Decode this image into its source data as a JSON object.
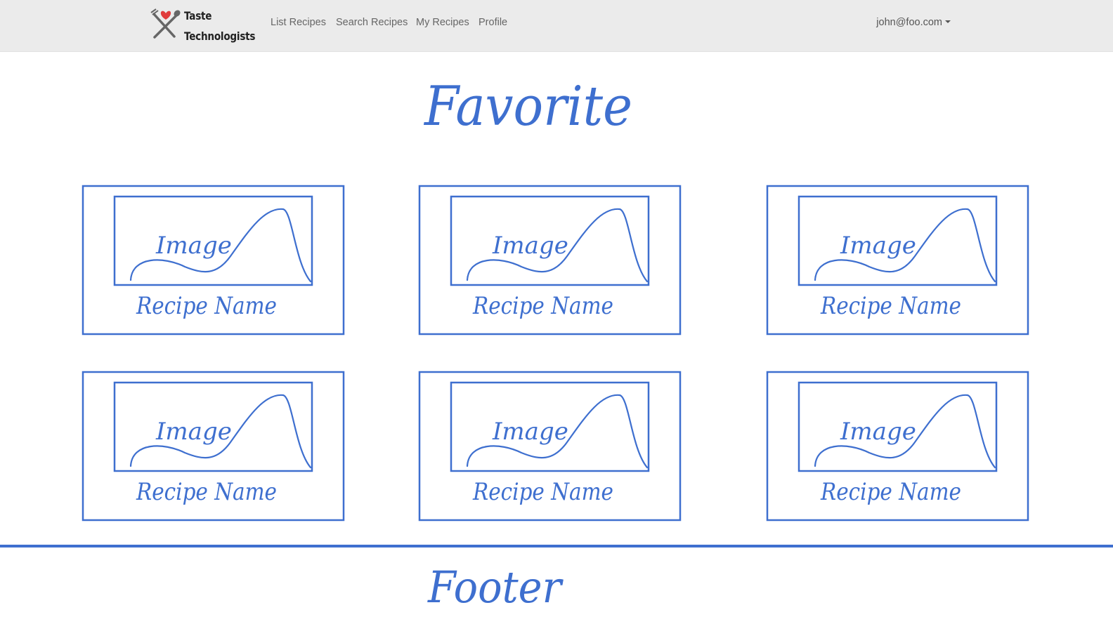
{
  "navbar": {
    "brand": {
      "line1": "Taste",
      "line2": "Technologists"
    },
    "links": [
      "List Recipes",
      "Search Recipes",
      "My Recipes",
      "Profile"
    ],
    "user": "john@foo.com"
  },
  "main": {
    "title": "Favorite",
    "cards": [
      {
        "image_label": "Image",
        "name": "Recipe Name"
      },
      {
        "image_label": "Image",
        "name": "Recipe Name"
      },
      {
        "image_label": "Image",
        "name": "Recipe Name"
      },
      {
        "image_label": "Image",
        "name": "Recipe Name"
      },
      {
        "image_label": "Image",
        "name": "Recipe Name"
      },
      {
        "image_label": "Image",
        "name": "Recipe Name"
      }
    ]
  },
  "footer": {
    "label": "Footer"
  },
  "colors": {
    "sketch": "#3e6fcf",
    "navbar_bg": "#ebebeb"
  },
  "icons": {
    "logo": "fork-spoon-heart-icon",
    "user_menu": "caret-down-icon"
  }
}
